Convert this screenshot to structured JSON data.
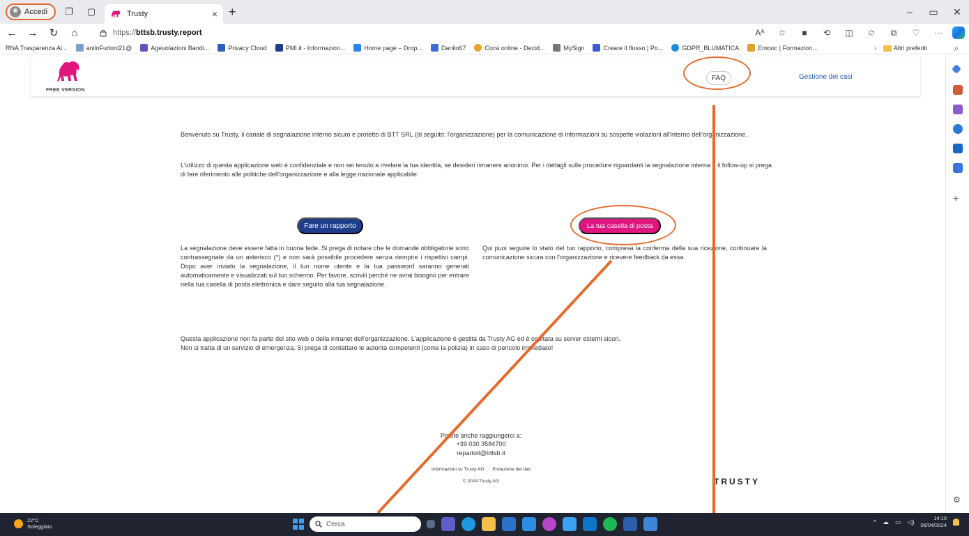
{
  "browser": {
    "profile_label": "Accedi",
    "tab_title": "Trusty",
    "tab_close": "×",
    "new_tab": "+",
    "url_scheme": "https://",
    "url_host": "bttsb.trusty.report",
    "url_path": "",
    "bookmarks": [
      "RNA Trasparenza Ai...",
      "aniloFurloni21@",
      "Agevolazioni Bandi...",
      "Privacy Cloud",
      "PMI.it - Informazion...",
      "Home page – Drop...",
      "Danilo67",
      "Corsi online - Decid...",
      "MySign",
      "Creare il flusso | Po...",
      "GDPR_BLUMATICA",
      "Emooc | Formazion..."
    ],
    "other_favorites": "Altri preferiti"
  },
  "header": {
    "logo_badge": "FREE VERSION",
    "faq_label": "FAQ",
    "case_management_label": "Gestione dei casi"
  },
  "main": {
    "intro_1": "Benvenuto su Trusty, il canale di segnalazione interno sicuro e protetto di BTT SRL (di seguito: l'organizzazione) per la comunicazione di informazioni su sospette violazioni all'interno dell'organizzazione.",
    "intro_2": "L'utilizzo di questa applicazione web è confidenziale e non sei tenuto a rivelare la tua identità, se desideri rimanere anonimo. Per i dettagli sulle procedure riguardanti la segnalazione interna e il follow-up si prega di fare riferimento alle politiche dell'organizzazione e alla legge nazionale applicabile.",
    "report_button": "Fare un rapporto",
    "inbox_button": "La tua casella di posta",
    "report_text": "La segnalazione deve essere fatta in buona fede. Si prega di notare che le domande obbligatorie sono contrassegnate da un asterisco (*) e non sarà possibile procedere senza riempire i rispettivi campi. Dopo aver inviato la segnalazione, il tuo nome utente e la tua password saranno generati automaticamente e visualizzati sul tuo schermo. Per favore, scrivili perché ne avrai bisogno per entrare nella tua casella di posta elettronica e dare seguito alla tua segnalazione.",
    "inbox_text": "Qui puoi seguire lo stato del tuo rapporto, compresa la conferma della sua ricezione, continuare la comunicazione sicura con l'organizzazione e ricevere feedback da essa.",
    "disclaimer_1": "Questa applicazione non fa parte del sito web o della intranet dell'organizzazione. L'applicazione è gestita da Trusty AG ed è ospitata su server esterni sicuri.",
    "disclaimer_2": "Non si tratta di un servizio di emergenza. Si prega di contattare le autorità competenti (come la polizia) in caso di pericolo immediato!"
  },
  "footer": {
    "contact_intro": "Potete anche raggiungerci a:",
    "phone": "+39 030 3584700",
    "email": "repartoit@bttsb.it",
    "link_info": "Informazioni su Trusty AG",
    "link_privacy": "Protezione dei dati",
    "copyright": "© 2024 Trusty AG",
    "brand": "TRUSTY"
  },
  "taskbar": {
    "temperature": "22°C",
    "weather": "Soleggiato",
    "search_placeholder": "Cerca",
    "time": "14:10",
    "date": "06/04/2024"
  },
  "colors": {
    "report_button": "#1e3e8c",
    "inbox_button": "#e1157f",
    "logo": "#e1157f",
    "annotation": "#e56b2c",
    "link": "#1e57b4"
  }
}
